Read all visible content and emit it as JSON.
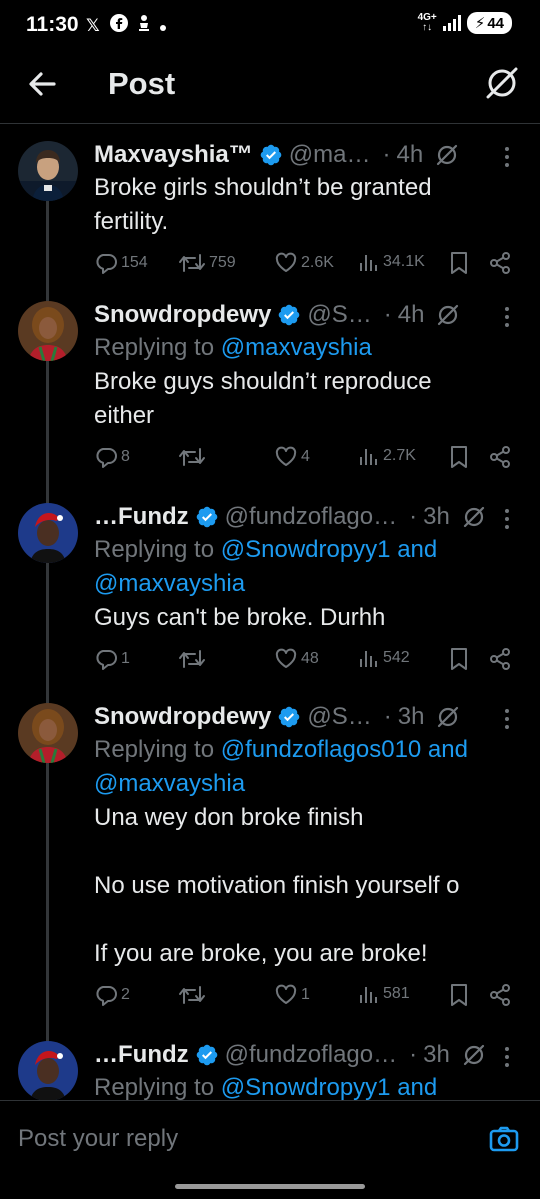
{
  "status_bar": {
    "time": "11:30",
    "network": "4G+",
    "battery": "44"
  },
  "header": {
    "title": "Post"
  },
  "tweets": [
    {
      "name": "Maxvayshia™",
      "handle": "@ma…",
      "time": "4h",
      "reply_prefix": "",
      "reply_targets": "",
      "text": "Broke girls shouldn’t be granted fertility.",
      "replies": "154",
      "reposts": "759",
      "likes": "2.6K",
      "views": "34.1K"
    },
    {
      "name": "Snowdropdewy",
      "handle": "@S…",
      "time": "4h",
      "reply_prefix": "Replying to ",
      "reply_targets": "@maxvayshia",
      "text": "Broke guys shouldn’t reproduce either",
      "replies": "8",
      "reposts": "",
      "likes": "4",
      "views": "2.7K"
    },
    {
      "name": "…Fundz",
      "handle": "@fundzoflago…",
      "time": "3h",
      "reply_prefix": "Replying to ",
      "reply_targets": "@Snowdropyy1 and @maxvayshia",
      "text": "Guys can't be broke. Durhh",
      "replies": "1",
      "reposts": "",
      "likes": "48",
      "views": "542"
    },
    {
      "name": "Snowdropdewy",
      "handle": "@S…",
      "time": "3h",
      "reply_prefix": "Replying to ",
      "reply_targets": "@fundzoflagos010 and @maxvayshia",
      "text": "Una wey don broke finish\n\nNo use motivation finish yourself o\n\nIf you are broke, you are broke!",
      "replies": "2",
      "reposts": "",
      "likes": "1",
      "views": "581"
    },
    {
      "name": "…Fundz",
      "handle": "@fundzoflago…",
      "time": "3h",
      "reply_prefix": "Replying to ",
      "reply_targets": "@Snowdropyy1 and",
      "text": "",
      "replies": "",
      "reposts": "",
      "likes": "",
      "views": ""
    }
  ],
  "composer": {
    "placeholder": "Post your reply"
  },
  "colors": {
    "accent": "#1d9bf0",
    "muted": "#71767b",
    "text": "#e7e9ea",
    "background": "#000000"
  }
}
